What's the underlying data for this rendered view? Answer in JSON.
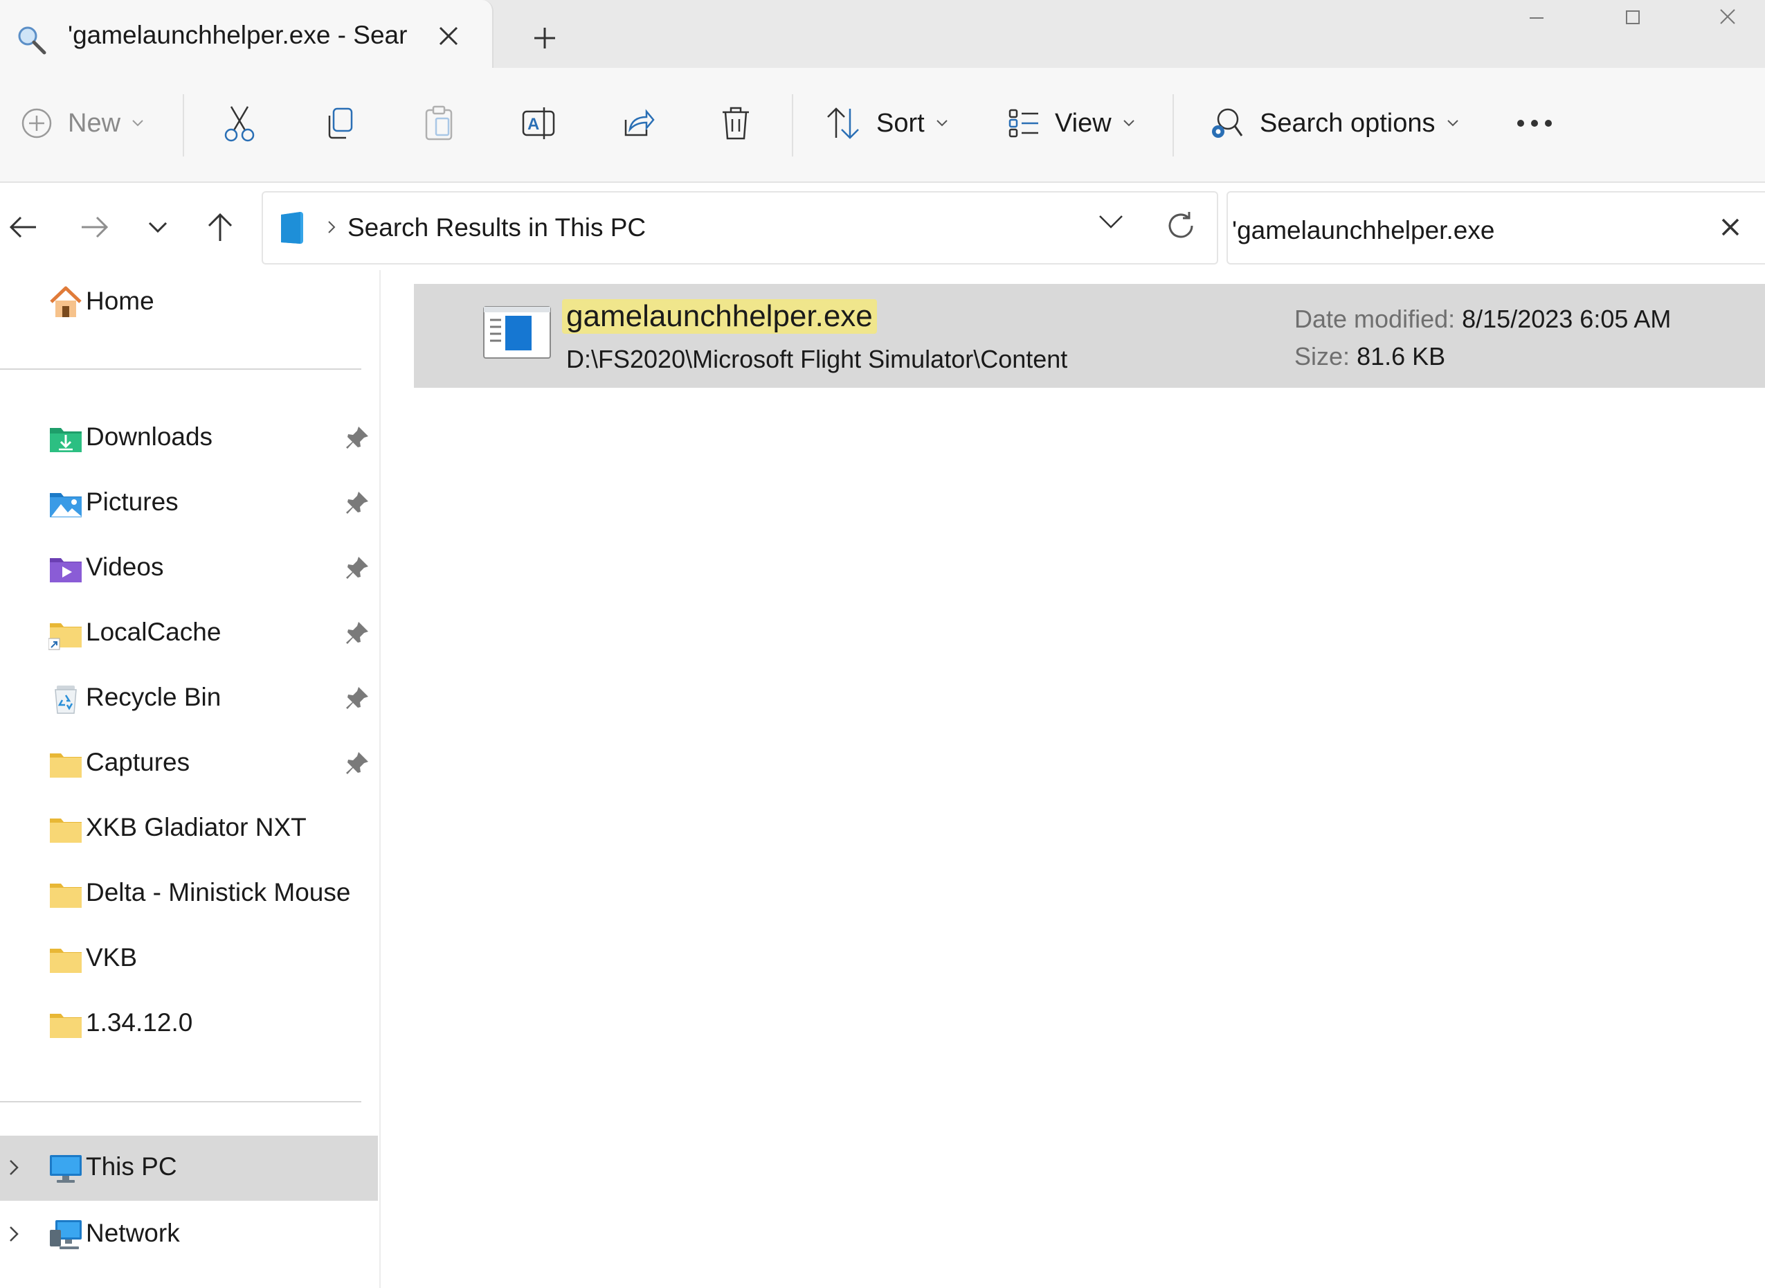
{
  "window": {
    "tab_title": "'gamelaunchhelper.exe - Sear"
  },
  "toolbar": {
    "new_label": "New",
    "sort_label": "Sort",
    "view_label": "View",
    "search_options_label": "Search options"
  },
  "address": {
    "location": "Search Results in This PC",
    "search_query": "'gamelaunchhelper.exe"
  },
  "sidebar": {
    "home": "Home",
    "quick_access": [
      {
        "label": "Downloads",
        "icon": "downloads-folder-icon",
        "pinned": true
      },
      {
        "label": "Pictures",
        "icon": "pictures-folder-icon",
        "pinned": true
      },
      {
        "label": "Videos",
        "icon": "videos-folder-icon",
        "pinned": true
      },
      {
        "label": "LocalCache",
        "icon": "shortcut-folder-icon",
        "pinned": true
      },
      {
        "label": "Recycle Bin",
        "icon": "recycle-bin-icon",
        "pinned": true
      },
      {
        "label": "Captures",
        "icon": "folder-icon",
        "pinned": true
      },
      {
        "label": "XKB Gladiator NXT",
        "icon": "folder-icon",
        "pinned": false
      },
      {
        "label": "Delta - Ministick Mouse",
        "icon": "folder-icon",
        "pinned": false
      },
      {
        "label": "VKB",
        "icon": "folder-icon",
        "pinned": false
      },
      {
        "label": "1.34.12.0",
        "icon": "folder-icon",
        "pinned": false
      }
    ],
    "this_pc": "This PC",
    "network": "Network"
  },
  "results": [
    {
      "name": "gamelaunchhelper.exe",
      "path": "D:\\FS2020\\Microsoft Flight Simulator\\Content",
      "date_label": "Date modified:",
      "date_value": "8/15/2023 6:05 AM",
      "size_label": "Size:",
      "size_value": "81.6 KB"
    }
  ],
  "colors": {
    "selection": "#d9d9d9",
    "highlight": "#f0e68c",
    "folder": "#f8d775"
  }
}
